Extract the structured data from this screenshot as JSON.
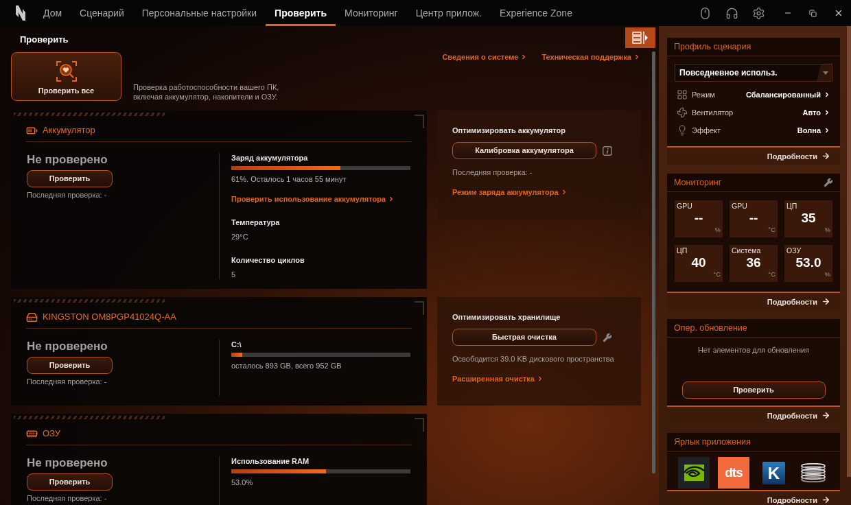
{
  "nav": {
    "items": [
      {
        "label": "Дом",
        "selected": false
      },
      {
        "label": "Сценарий",
        "selected": false
      },
      {
        "label": "Персональные настройки",
        "selected": false
      },
      {
        "label": "Проверить",
        "selected": true
      },
      {
        "label": "Мониторинг",
        "selected": false
      },
      {
        "label": "Центр прилож.",
        "selected": false
      },
      {
        "label": "Experience Zone",
        "selected": false
      }
    ]
  },
  "page": {
    "title": "Проверить",
    "check_all": "Проверить все",
    "description": "Проверка работоспособности вашего ПК, включая аккумулятор, накопители и ОЗУ.",
    "links": [
      "Сведения о системе",
      "Техническая поддержка"
    ]
  },
  "sections": [
    {
      "kind": "battery",
      "title": "Аккумулятор",
      "status": "Не проверено",
      "button": "Проверить",
      "last_check": "Последняя проверка: -",
      "details": [
        {
          "kind": "meter",
          "label": "Заряд аккумулятора",
          "level": 0.61,
          "text": "61%. Осталось 1 часов 55 минут"
        },
        {
          "kind": "link",
          "text": "Проверить использование аккумулятора"
        },
        {
          "kind": "stat",
          "label": "Температура",
          "value": "29°C"
        },
        {
          "kind": "stat",
          "label": "Количество циклов",
          "value": "5"
        }
      ],
      "optimize": {
        "title": "Оптимизировать аккумулятор",
        "button": "Калибровка аккумулятора",
        "lines": [
          {
            "kind": "text",
            "text": "Последняя проверка: -"
          },
          {
            "kind": "link",
            "text": "Режим заряда аккумулятора"
          }
        ]
      }
    },
    {
      "kind": "storage",
      "title": "KINGSTON OM8PGP41024Q-AA",
      "status": "Не проверено",
      "button": "Проверить",
      "last_check": "Последняя проверка: -",
      "details": [
        {
          "kind": "meter",
          "label": "C:\\",
          "level": 0.06,
          "text": "осталось 893 GB, всего 952 GB"
        }
      ],
      "optimize": {
        "title": "Оптимизировать хранилище",
        "button": "Быстрая очистка",
        "lines": [
          {
            "kind": "text",
            "text": "Освободится 39.0 KB дискового пространства"
          },
          {
            "kind": "link",
            "text": "Расширенная очистка"
          }
        ]
      }
    },
    {
      "kind": "memory",
      "title": "ОЗУ",
      "status": "Не проверено",
      "button": "Проверить",
      "last_check": "Последняя проверка: -",
      "details": [
        {
          "kind": "meter",
          "label": "Использование RAM",
          "level": 0.53,
          "text": "53.0%"
        }
      ]
    }
  ],
  "side": {
    "profile": {
      "title": "Профиль сценария",
      "dropdown": "Повседневное использ.",
      "rows": [
        {
          "label": "Режим",
          "value": "Сбалансированный"
        },
        {
          "label": "Вентилятор",
          "value": "Авто"
        },
        {
          "label": "Эффект",
          "value": "Волна"
        }
      ],
      "footer": "Подробности"
    },
    "monitoring": {
      "title": "Мониторинг",
      "tiles": [
        {
          "label": "GPU",
          "value": "--",
          "unit": "%"
        },
        {
          "label": "GPU",
          "value": "--",
          "unit": "°C"
        },
        {
          "label": "ЦП",
          "value": "35",
          "unit": "%"
        },
        {
          "label": "ЦП",
          "value": "40",
          "unit": "°C"
        },
        {
          "label": "Система",
          "value": "36",
          "unit": "°C"
        },
        {
          "label": "ОЗУ",
          "value": "53.0",
          "unit": "%"
        }
      ],
      "footer": "Подробности"
    },
    "update": {
      "title": "Опер. обновление",
      "message": "Нет элементов для обновления",
      "button": "Проверить",
      "footer": "Подробности"
    },
    "shortcuts": {
      "title": "Ярлык приложения",
      "apps": [
        {
          "kind": "swirl"
        },
        {
          "kind": "wordmark",
          "text": "dts"
        },
        {
          "kind": "letter",
          "text": "K"
        },
        {
          "kind": "coil"
        }
      ],
      "footer": "Подробности"
    }
  }
}
